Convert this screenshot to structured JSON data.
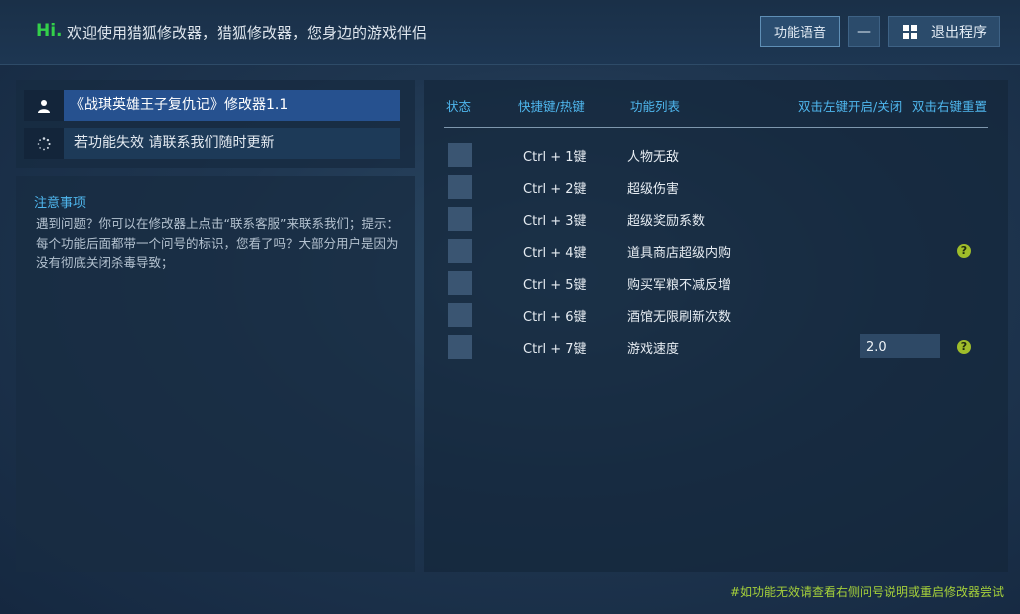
{
  "header": {
    "hi": "Hi.",
    "welcome": "欢迎使用猎狐修改器，猎狐修改器，您身边的游戏伴侣",
    "voice_button": "功能语音",
    "minimize_button": "—",
    "exit_button": "退出程序"
  },
  "left": {
    "title": "《战琪英雄王子复仇记》修改器1.1",
    "notice": "若功能失效  请联系我们随时更新",
    "notes_title": "注意事项",
    "notes_body": "遇到问题？你可以在修改器上点击“联系客服”来联系我们；提示：每个功能后面都带一个问号的标识，您看了吗？大部分用户是因为没有彻底关闭杀毒导致；"
  },
  "table": {
    "col_status": "状态",
    "col_hotkey": "快捷键/热键",
    "col_function": "功能列表",
    "hint_left": "双击左键开启/关闭",
    "hint_right": "双击右键重置",
    "rows": [
      {
        "hotkey": "Ctrl  +  1键",
        "name": "人物无敌"
      },
      {
        "hotkey": "Ctrl  +  2键",
        "name": "超级伤害"
      },
      {
        "hotkey": "Ctrl  +  3键",
        "name": "超级奖励系数"
      },
      {
        "hotkey": "Ctrl  +  4键",
        "name": "道具商店超级内购"
      },
      {
        "hotkey": "Ctrl  +  5键",
        "name": "购买军粮不减反增"
      },
      {
        "hotkey": "Ctrl  +  6键",
        "name": "酒馆无限刷新次数"
      },
      {
        "hotkey": "Ctrl  +  7键",
        "name": "游戏速度",
        "value": "2.0"
      }
    ],
    "help_icon": "?"
  },
  "footer": "#如功能无效请查看右侧问号说明或重启修改器尝试",
  "colors": {
    "accent": "#4fb7ee",
    "hi": "#33d04a",
    "footer": "#a6d13a",
    "title_bg": "#26518f"
  }
}
